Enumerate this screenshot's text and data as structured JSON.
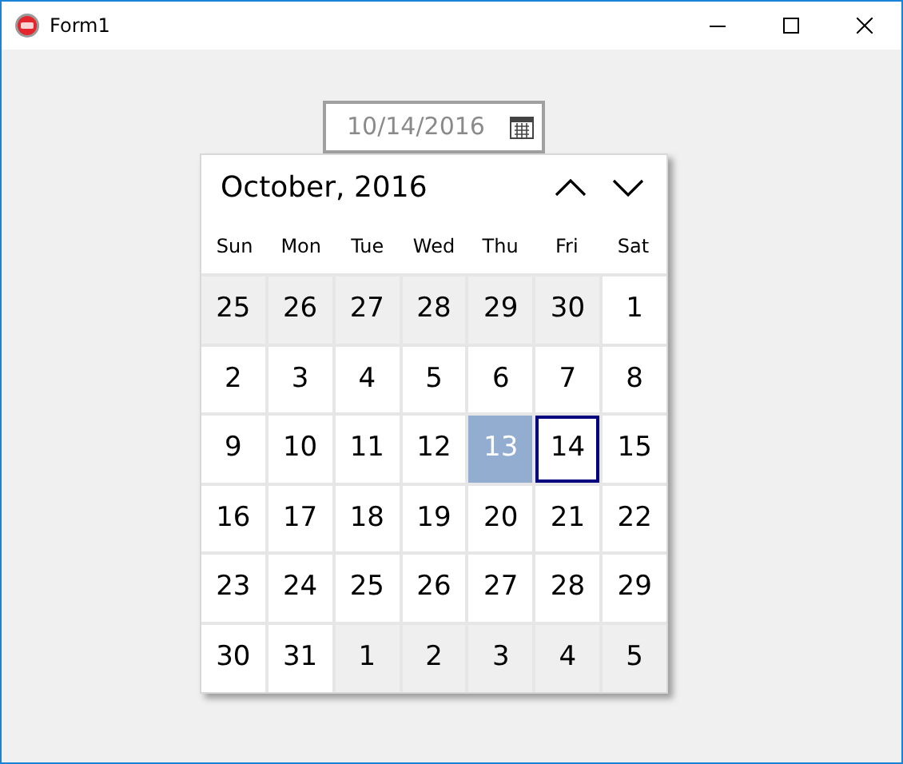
{
  "window": {
    "title": "Form1"
  },
  "date_field": {
    "value": "10/14/2016"
  },
  "calendar": {
    "month_title": "October, 2016",
    "weekdays": [
      "Sun",
      "Mon",
      "Tue",
      "Wed",
      "Thu",
      "Fri",
      "Sat"
    ],
    "days": [
      {
        "label": "25",
        "other_month": true,
        "selected": false,
        "hovered": false
      },
      {
        "label": "26",
        "other_month": true,
        "selected": false,
        "hovered": false
      },
      {
        "label": "27",
        "other_month": true,
        "selected": false,
        "hovered": false
      },
      {
        "label": "28",
        "other_month": true,
        "selected": false,
        "hovered": false
      },
      {
        "label": "29",
        "other_month": true,
        "selected": false,
        "hovered": false
      },
      {
        "label": "30",
        "other_month": true,
        "selected": false,
        "hovered": false
      },
      {
        "label": "1",
        "other_month": false,
        "selected": false,
        "hovered": false
      },
      {
        "label": "2",
        "other_month": false,
        "selected": false,
        "hovered": false
      },
      {
        "label": "3",
        "other_month": false,
        "selected": false,
        "hovered": false
      },
      {
        "label": "4",
        "other_month": false,
        "selected": false,
        "hovered": false
      },
      {
        "label": "5",
        "other_month": false,
        "selected": false,
        "hovered": false
      },
      {
        "label": "6",
        "other_month": false,
        "selected": false,
        "hovered": false
      },
      {
        "label": "7",
        "other_month": false,
        "selected": false,
        "hovered": false
      },
      {
        "label": "8",
        "other_month": false,
        "selected": false,
        "hovered": false
      },
      {
        "label": "9",
        "other_month": false,
        "selected": false,
        "hovered": false
      },
      {
        "label": "10",
        "other_month": false,
        "selected": false,
        "hovered": false
      },
      {
        "label": "11",
        "other_month": false,
        "selected": false,
        "hovered": false
      },
      {
        "label": "12",
        "other_month": false,
        "selected": false,
        "hovered": false
      },
      {
        "label": "13",
        "other_month": false,
        "selected": false,
        "hovered": true
      },
      {
        "label": "14",
        "other_month": false,
        "selected": true,
        "hovered": false
      },
      {
        "label": "15",
        "other_month": false,
        "selected": false,
        "hovered": false
      },
      {
        "label": "16",
        "other_month": false,
        "selected": false,
        "hovered": false
      },
      {
        "label": "17",
        "other_month": false,
        "selected": false,
        "hovered": false
      },
      {
        "label": "18",
        "other_month": false,
        "selected": false,
        "hovered": false
      },
      {
        "label": "19",
        "other_month": false,
        "selected": false,
        "hovered": false
      },
      {
        "label": "20",
        "other_month": false,
        "selected": false,
        "hovered": false
      },
      {
        "label": "21",
        "other_month": false,
        "selected": false,
        "hovered": false
      },
      {
        "label": "22",
        "other_month": false,
        "selected": false,
        "hovered": false
      },
      {
        "label": "23",
        "other_month": false,
        "selected": false,
        "hovered": false
      },
      {
        "label": "24",
        "other_month": false,
        "selected": false,
        "hovered": false
      },
      {
        "label": "25",
        "other_month": false,
        "selected": false,
        "hovered": false
      },
      {
        "label": "26",
        "other_month": false,
        "selected": false,
        "hovered": false
      },
      {
        "label": "27",
        "other_month": false,
        "selected": false,
        "hovered": false
      },
      {
        "label": "28",
        "other_month": false,
        "selected": false,
        "hovered": false
      },
      {
        "label": "29",
        "other_month": false,
        "selected": false,
        "hovered": false
      },
      {
        "label": "30",
        "other_month": false,
        "selected": false,
        "hovered": false
      },
      {
        "label": "31",
        "other_month": false,
        "selected": false,
        "hovered": false
      },
      {
        "label": "1",
        "other_month": true,
        "selected": false,
        "hovered": false
      },
      {
        "label": "2",
        "other_month": true,
        "selected": false,
        "hovered": false
      },
      {
        "label": "3",
        "other_month": true,
        "selected": false,
        "hovered": false
      },
      {
        "label": "4",
        "other_month": true,
        "selected": false,
        "hovered": false
      },
      {
        "label": "5",
        "other_month": true,
        "selected": false,
        "hovered": false
      }
    ]
  }
}
